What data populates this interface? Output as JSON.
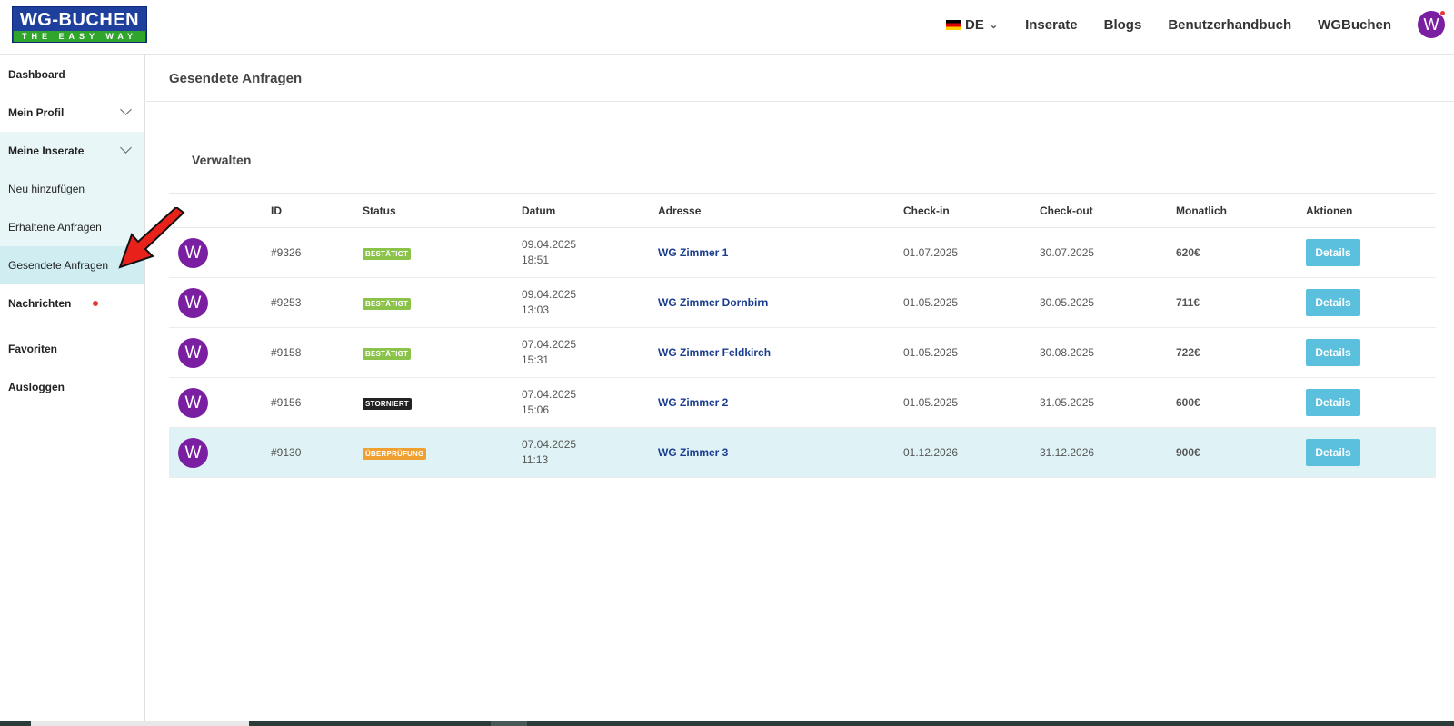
{
  "header": {
    "logo_top": "WG-BUCHEN",
    "logo_bottom": "THE EASY WAY",
    "language": "DE",
    "nav": [
      "Inserate",
      "Blogs",
      "Benutzerhandbuch",
      "WGBuchen"
    ],
    "avatar_letter": "W"
  },
  "sidebar": {
    "items": [
      {
        "label": "Dashboard"
      },
      {
        "label": "Mein Profil"
      },
      {
        "label": "Meine Inserate"
      },
      {
        "label": "Neu hinzufügen"
      },
      {
        "label": "Erhaltene Anfragen"
      },
      {
        "label": "Gesendete Anfragen"
      },
      {
        "label": "Nachrichten"
      },
      {
        "label": "Favoriten"
      },
      {
        "label": "Ausloggen"
      }
    ]
  },
  "main": {
    "title": "Gesendete Anfragen",
    "section": "Verwalten",
    "columns": [
      "ID",
      "Status",
      "Datum",
      "Adresse",
      "Check-in",
      "Check-out",
      "Monatlich",
      "Aktionen"
    ],
    "rows": [
      {
        "avatar": "W",
        "id": "#9326",
        "status": "BESTÄTIGT",
        "status_color": "#8bc34a",
        "date": "09.04.2025",
        "time": "18:51",
        "address": "WG Zimmer 1",
        "checkin": "01.07.2025",
        "checkout": "30.07.2025",
        "monthly": "620€",
        "action": "Details"
      },
      {
        "avatar": "W",
        "id": "#9253",
        "status": "BESTÄTIGT",
        "status_color": "#8bc34a",
        "date": "09.04.2025",
        "time": "13:03",
        "address": "WG Zimmer Dornbirn",
        "checkin": "01.05.2025",
        "checkout": "30.05.2025",
        "monthly": "711€",
        "action": "Details"
      },
      {
        "avatar": "W",
        "id": "#9158",
        "status": "BESTÄTIGT",
        "status_color": "#8bc34a",
        "date": "07.04.2025",
        "time": "15:31",
        "address": "WG Zimmer Feldkirch",
        "checkin": "01.05.2025",
        "checkout": "30.08.2025",
        "monthly": "722€",
        "action": "Details"
      },
      {
        "avatar": "W",
        "id": "#9156",
        "status": "STORNIERT",
        "status_color": "#222222",
        "date": "07.04.2025",
        "time": "15:06",
        "address": "WG Zimmer 2",
        "checkin": "01.05.2025",
        "checkout": "31.05.2025",
        "monthly": "600€",
        "action": "Details"
      },
      {
        "avatar": "W",
        "id": "#9130",
        "status": "ÜBERPRÜFUNG",
        "status_color": "#f0a030",
        "date": "07.04.2025",
        "time": "11:13",
        "address": "WG Zimmer 3",
        "checkin": "01.12.2026",
        "checkout": "31.12.2026",
        "monthly": "900€",
        "action": "Details"
      }
    ]
  }
}
